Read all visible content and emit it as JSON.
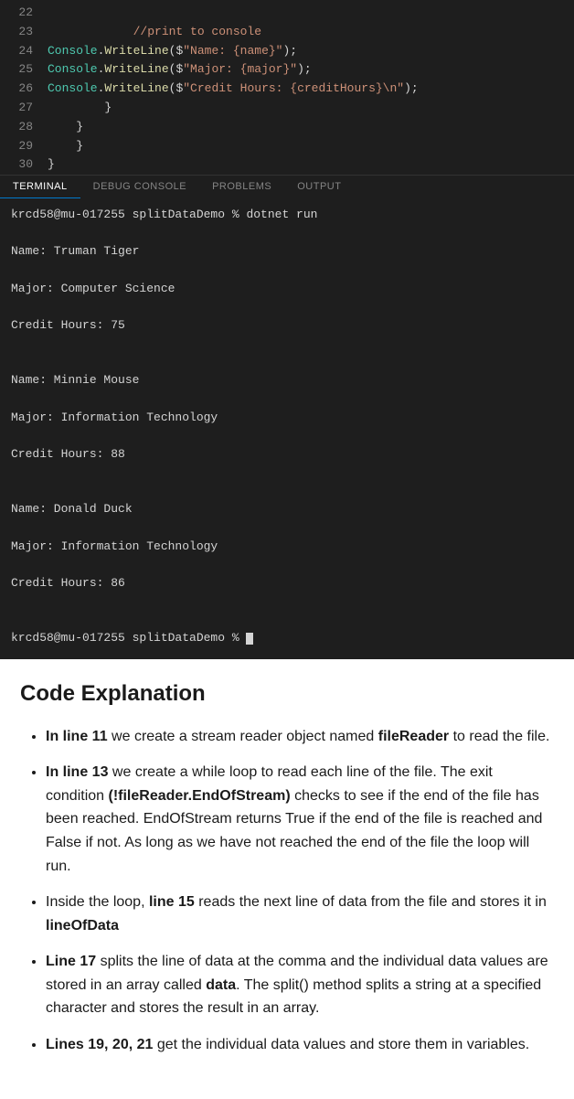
{
  "editor": {
    "lines": [
      {
        "num": "22",
        "content": ""
      },
      {
        "num": "23",
        "content": "            //print to console"
      },
      {
        "num": "24",
        "content": "            Console.WriteLine($\"Name: {name}\");"
      },
      {
        "num": "25",
        "content": "            Console.WriteLine($\"Major: {major}\");"
      },
      {
        "num": "26",
        "content": "            Console.WriteLine($\"Credit Hours: {creditHours}\\n\");"
      },
      {
        "num": "27",
        "content": "        }"
      },
      {
        "num": "28",
        "content": "    }"
      },
      {
        "num": "29",
        "content": "    }"
      },
      {
        "num": "30",
        "content": "}"
      }
    ]
  },
  "terminal": {
    "tabs": [
      {
        "label": "TERMINAL",
        "active": true
      },
      {
        "label": "DEBUG CONSOLE",
        "active": false
      },
      {
        "label": "PROBLEMS",
        "active": false
      },
      {
        "label": "OUTPUT",
        "active": false
      }
    ],
    "lines": [
      "krcd58@mu-017255 splitDataDemo % dotnet run",
      "Name: Truman Tiger",
      "Major: Computer Science",
      "Credit Hours: 75",
      "",
      "Name: Minnie Mouse",
      "Major: Information Technology",
      "Credit Hours: 88",
      "",
      "Name: Donald Duck",
      "Major: Information Technology",
      "Credit Hours: 86",
      "",
      "krcd58@mu-017255 splitDataDemo % "
    ]
  },
  "content": {
    "title": "Code Explanation",
    "bullets": [
      {
        "id": 1,
        "text_before": "",
        "bold_start": "In line 11",
        "text_after": " we create a stream reader object named ",
        "bold_mid": "fileReader",
        "text_end": " to read the file."
      },
      {
        "id": 2,
        "bold_start": "In line 13",
        "text_after": " we create a while loop to read each line of the file. The exit condition ",
        "bold_mid": "(!fileReader.EndOfStream)",
        "text_end": " checks to see if the end of the file has been reached. EndOfStream returns True if the end of the file is reached and False if not. As long as we have not reached the end of the file the loop will run."
      },
      {
        "id": 3,
        "text_prefix": "Inside the loop, ",
        "bold_start": "line 15",
        "text_after": " reads the next line of data from the file and stores it in ",
        "bold_end": "lineOfData"
      },
      {
        "id": 4,
        "bold_start": "Line 17",
        "text_after": " splits the line of data at the comma and the individual data values are stored in an array called ",
        "bold_mid": "data",
        "text_end": ". The split() method splits a string at a specified character and stores the result in an array."
      },
      {
        "id": 5,
        "bold_start": "Lines 19, 20, 21",
        "text_after": " get the individual data values and store them in variables."
      }
    ]
  }
}
